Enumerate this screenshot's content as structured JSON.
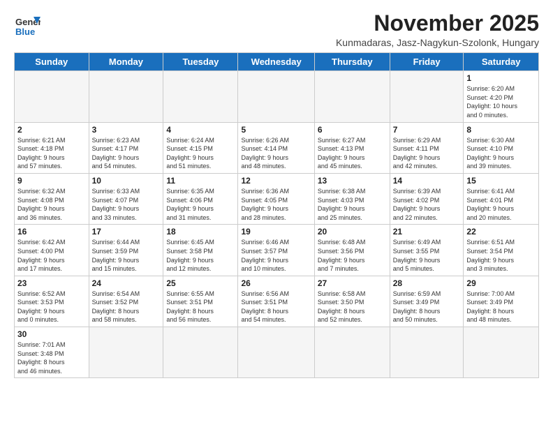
{
  "logo": {
    "text_general": "General",
    "text_blue": "Blue"
  },
  "title": "November 2025",
  "subtitle": "Kunmadaras, Jasz-Nagykun-Szolonk, Hungary",
  "days_of_week": [
    "Sunday",
    "Monday",
    "Tuesday",
    "Wednesday",
    "Thursday",
    "Friday",
    "Saturday"
  ],
  "weeks": [
    [
      {
        "day": "",
        "info": ""
      },
      {
        "day": "",
        "info": ""
      },
      {
        "day": "",
        "info": ""
      },
      {
        "day": "",
        "info": ""
      },
      {
        "day": "",
        "info": ""
      },
      {
        "day": "",
        "info": ""
      },
      {
        "day": "1",
        "info": "Sunrise: 6:20 AM\nSunset: 4:20 PM\nDaylight: 10 hours\nand 0 minutes."
      }
    ],
    [
      {
        "day": "2",
        "info": "Sunrise: 6:21 AM\nSunset: 4:18 PM\nDaylight: 9 hours\nand 57 minutes."
      },
      {
        "day": "3",
        "info": "Sunrise: 6:23 AM\nSunset: 4:17 PM\nDaylight: 9 hours\nand 54 minutes."
      },
      {
        "day": "4",
        "info": "Sunrise: 6:24 AM\nSunset: 4:15 PM\nDaylight: 9 hours\nand 51 minutes."
      },
      {
        "day": "5",
        "info": "Sunrise: 6:26 AM\nSunset: 4:14 PM\nDaylight: 9 hours\nand 48 minutes."
      },
      {
        "day": "6",
        "info": "Sunrise: 6:27 AM\nSunset: 4:13 PM\nDaylight: 9 hours\nand 45 minutes."
      },
      {
        "day": "7",
        "info": "Sunrise: 6:29 AM\nSunset: 4:11 PM\nDaylight: 9 hours\nand 42 minutes."
      },
      {
        "day": "8",
        "info": "Sunrise: 6:30 AM\nSunset: 4:10 PM\nDaylight: 9 hours\nand 39 minutes."
      }
    ],
    [
      {
        "day": "9",
        "info": "Sunrise: 6:32 AM\nSunset: 4:08 PM\nDaylight: 9 hours\nand 36 minutes."
      },
      {
        "day": "10",
        "info": "Sunrise: 6:33 AM\nSunset: 4:07 PM\nDaylight: 9 hours\nand 33 minutes."
      },
      {
        "day": "11",
        "info": "Sunrise: 6:35 AM\nSunset: 4:06 PM\nDaylight: 9 hours\nand 31 minutes."
      },
      {
        "day": "12",
        "info": "Sunrise: 6:36 AM\nSunset: 4:05 PM\nDaylight: 9 hours\nand 28 minutes."
      },
      {
        "day": "13",
        "info": "Sunrise: 6:38 AM\nSunset: 4:03 PM\nDaylight: 9 hours\nand 25 minutes."
      },
      {
        "day": "14",
        "info": "Sunrise: 6:39 AM\nSunset: 4:02 PM\nDaylight: 9 hours\nand 22 minutes."
      },
      {
        "day": "15",
        "info": "Sunrise: 6:41 AM\nSunset: 4:01 PM\nDaylight: 9 hours\nand 20 minutes."
      }
    ],
    [
      {
        "day": "16",
        "info": "Sunrise: 6:42 AM\nSunset: 4:00 PM\nDaylight: 9 hours\nand 17 minutes."
      },
      {
        "day": "17",
        "info": "Sunrise: 6:44 AM\nSunset: 3:59 PM\nDaylight: 9 hours\nand 15 minutes."
      },
      {
        "day": "18",
        "info": "Sunrise: 6:45 AM\nSunset: 3:58 PM\nDaylight: 9 hours\nand 12 minutes."
      },
      {
        "day": "19",
        "info": "Sunrise: 6:46 AM\nSunset: 3:57 PM\nDaylight: 9 hours\nand 10 minutes."
      },
      {
        "day": "20",
        "info": "Sunrise: 6:48 AM\nSunset: 3:56 PM\nDaylight: 9 hours\nand 7 minutes."
      },
      {
        "day": "21",
        "info": "Sunrise: 6:49 AM\nSunset: 3:55 PM\nDaylight: 9 hours\nand 5 minutes."
      },
      {
        "day": "22",
        "info": "Sunrise: 6:51 AM\nSunset: 3:54 PM\nDaylight: 9 hours\nand 3 minutes."
      }
    ],
    [
      {
        "day": "23",
        "info": "Sunrise: 6:52 AM\nSunset: 3:53 PM\nDaylight: 9 hours\nand 0 minutes."
      },
      {
        "day": "24",
        "info": "Sunrise: 6:54 AM\nSunset: 3:52 PM\nDaylight: 8 hours\nand 58 minutes."
      },
      {
        "day": "25",
        "info": "Sunrise: 6:55 AM\nSunset: 3:51 PM\nDaylight: 8 hours\nand 56 minutes."
      },
      {
        "day": "26",
        "info": "Sunrise: 6:56 AM\nSunset: 3:51 PM\nDaylight: 8 hours\nand 54 minutes."
      },
      {
        "day": "27",
        "info": "Sunrise: 6:58 AM\nSunset: 3:50 PM\nDaylight: 8 hours\nand 52 minutes."
      },
      {
        "day": "28",
        "info": "Sunrise: 6:59 AM\nSunset: 3:49 PM\nDaylight: 8 hours\nand 50 minutes."
      },
      {
        "day": "29",
        "info": "Sunrise: 7:00 AM\nSunset: 3:49 PM\nDaylight: 8 hours\nand 48 minutes."
      }
    ],
    [
      {
        "day": "30",
        "info": "Sunrise: 7:01 AM\nSunset: 3:48 PM\nDaylight: 8 hours\nand 46 minutes."
      },
      {
        "day": "",
        "info": ""
      },
      {
        "day": "",
        "info": ""
      },
      {
        "day": "",
        "info": ""
      },
      {
        "day": "",
        "info": ""
      },
      {
        "day": "",
        "info": ""
      },
      {
        "day": "",
        "info": ""
      }
    ]
  ]
}
